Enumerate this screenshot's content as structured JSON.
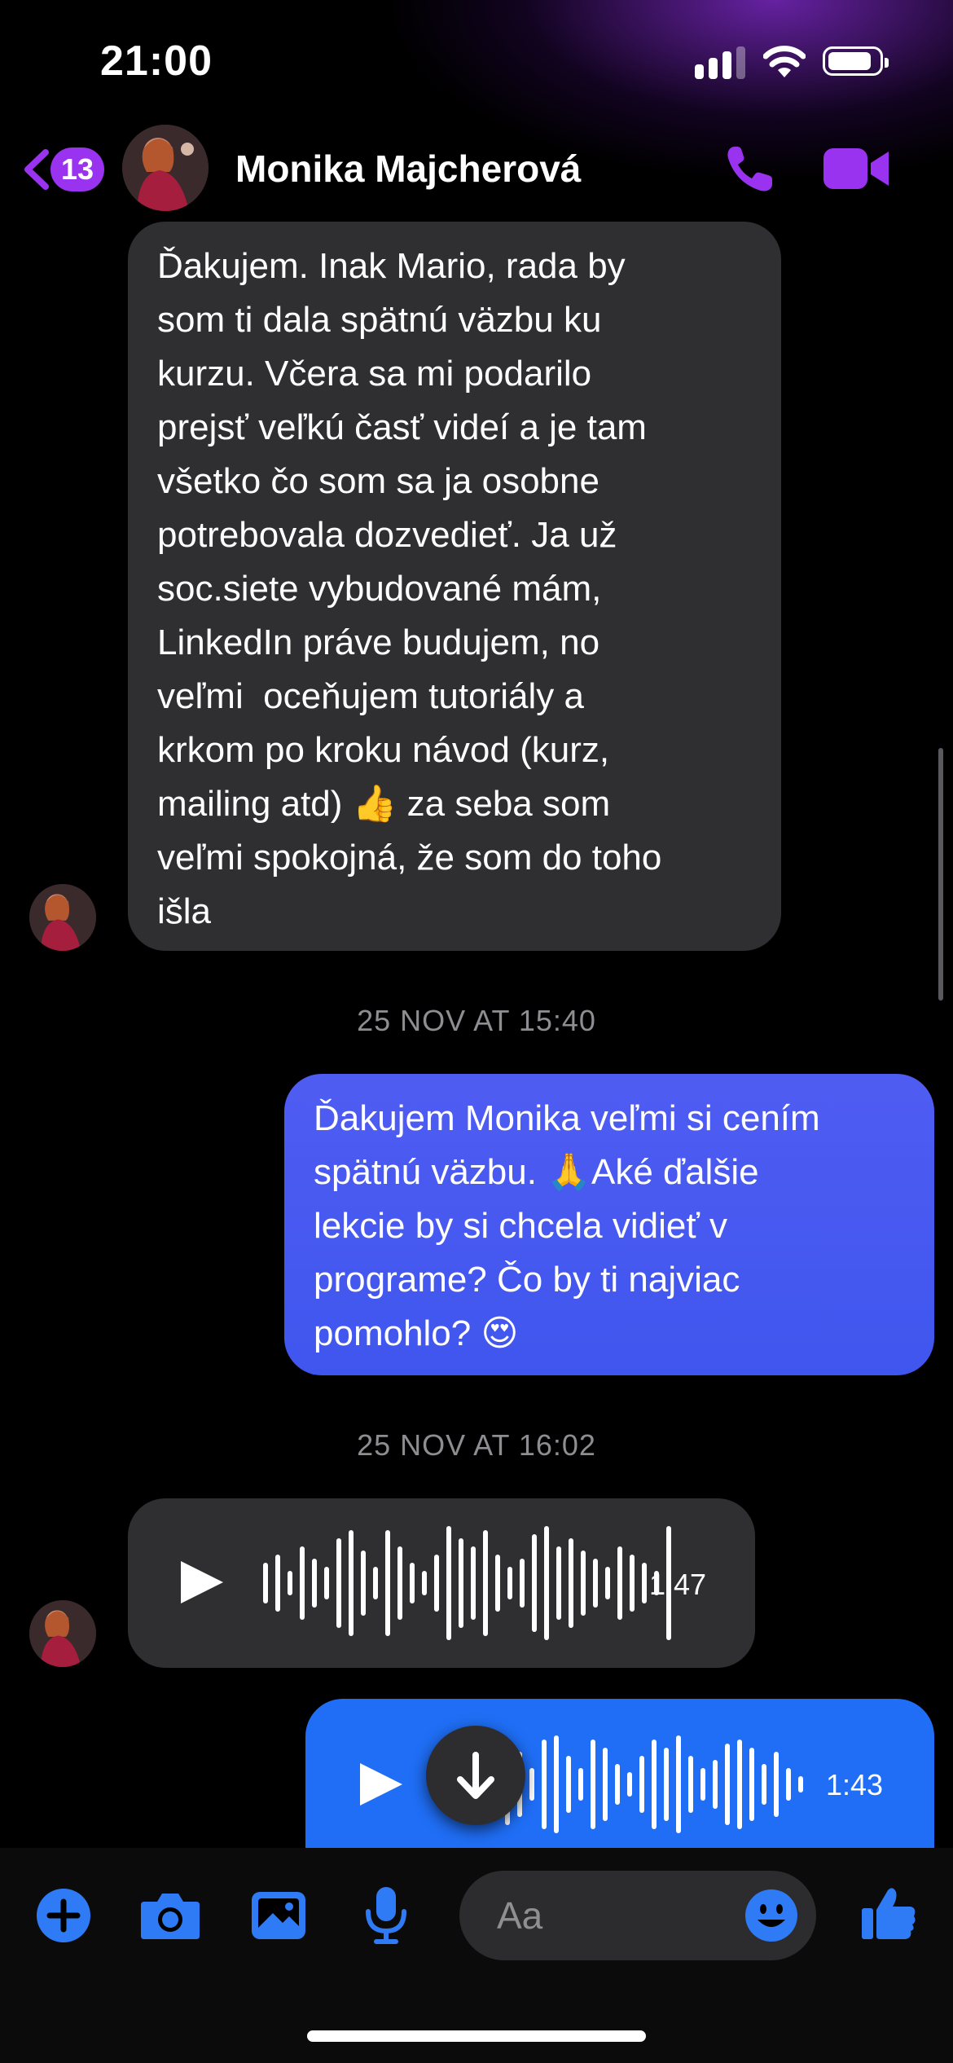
{
  "status_bar": {
    "time": "21:00"
  },
  "header": {
    "back_count": "13",
    "contact_name": "Monika Majcherová",
    "call_icon": "phone-icon",
    "video_icon": "video-camera-icon",
    "accent_color": "#9a33f0"
  },
  "messages": [
    {
      "direction": "incoming",
      "text": "Ďakujem. Inak Mario, rada by\nsom ti dala spätnú väzbu ku\nkurzu. Včera sa mi podarilo\nprejsť veľkú časť videí a je tam\nvšetko čo som sa ja osobne\npotrebovala dozvedieť. Ja už\nsoc.siete vybudované mám,\nLinkedIn práve budujem, no\nveľmi  oceňujem tutoriály a\nkrkom po kroku návod (kurz,\nmailing atd) 👍 za seba som\nveľmi spokojná, že som do toho\nišla"
    },
    {
      "timestamp": "25 NOV AT 15:40"
    },
    {
      "direction": "outgoing",
      "text": "Ďakujem Monika veľmi si cením\nspätnú väzbu. 🙏Aké ďalšie\nlekcie by si chcela vidieť v\nprograme? Čo by ti najviac\npomohlo? 😍"
    },
    {
      "timestamp": "25 NOV AT 16:02"
    },
    {
      "direction": "incoming",
      "type": "voice",
      "duration": "1:47"
    },
    {
      "direction": "outgoing",
      "type": "voice",
      "duration": "1:43"
    }
  ],
  "composer": {
    "placeholder": "Aa",
    "tools": [
      "plus-icon",
      "camera-icon",
      "gallery-icon",
      "microphone-icon",
      "emoji-icon",
      "thumbs-up-icon"
    ],
    "tool_color": "#2f7bf5"
  }
}
